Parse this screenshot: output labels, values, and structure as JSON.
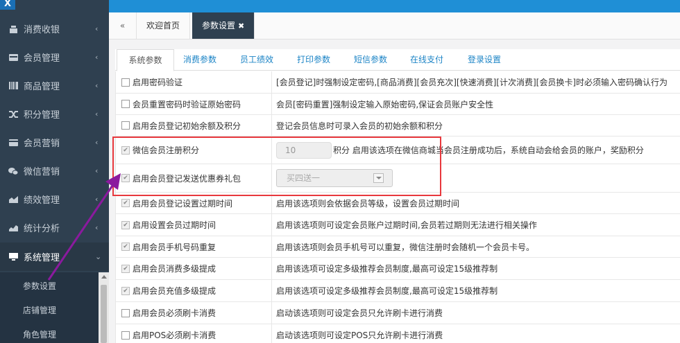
{
  "logo": {
    "text": "X"
  },
  "sidebar": {
    "items": [
      {
        "label": "消费收银",
        "icon": "cash-register-icon"
      },
      {
        "label": "会员管理",
        "icon": "id-card-icon"
      },
      {
        "label": "商品管理",
        "icon": "barcode-icon"
      },
      {
        "label": "积分管理",
        "icon": "shuffle-icon"
      },
      {
        "label": "会员营销",
        "icon": "credit-card-icon"
      },
      {
        "label": "微信营销",
        "icon": "wechat-icon"
      },
      {
        "label": "绩效管理",
        "icon": "area-chart-icon"
      },
      {
        "label": "统计分析",
        "icon": "bar-chart-icon"
      },
      {
        "label": "系统管理",
        "icon": "monitor-icon"
      }
    ],
    "submenu": [
      "参数设置",
      "店铺管理",
      "角色管理"
    ]
  },
  "tabs": {
    "back_icon": "«",
    "items": [
      "欢迎首页",
      "参数设置"
    ],
    "close": "✖"
  },
  "subtabs": [
    "系统参数",
    "消费参数",
    "员工绩效",
    "打印参数",
    "短信参数",
    "在线支付",
    "登录设置"
  ],
  "rows": [
    {
      "label": "启用密码验证",
      "desc": "[会员登记]时强制设定密码,[商品消费][会员充次][快速消费][计次消费][会员换卡]时必须输入密码确认行为",
      "checked": false
    },
    {
      "label": "会员重置密码时验证原始密码",
      "desc": "会员[密码重置]强制设定输入原始密码,保证会员账户安全性",
      "checked": false
    },
    {
      "label": "启用会员登记初始余额及积分",
      "desc": "登记会员信息时可录入会员的初始余额和积分",
      "checked": false
    },
    {
      "label": "微信会员注册积分",
      "input_value": "10",
      "desc": "积分 启用该选项在微信商城当会员注册成功后，系统自动会给会员的账户，奖励积分",
      "checked": true
    },
    {
      "label": "启用会员登记发送优惠券礼包",
      "select_value": "买四送一",
      "desc": "",
      "checked": true
    },
    {
      "label": "启用会员登记设置过期时间",
      "desc": "启用该选项则会依据会员等级，设置会员过期时间",
      "checked": true
    },
    {
      "label": "启用设置会员过期时间",
      "desc": "启用该选项则可设定会员账户过期时间,会员若过期则无法进行相关操作",
      "checked": true
    },
    {
      "label": "启用会员手机号码重复",
      "desc": "启用该选项则会员手机号可以重复，微信注册时会随机一个会员卡号。",
      "checked": true
    },
    {
      "label": "启用会员消费多级提成",
      "desc": "启用该选项可设定多级推荐会员制度,最高可设定15级推荐制",
      "checked": true
    },
    {
      "label": "启用会员充值多级提成",
      "desc": "启用该选项可设定多级推荐会员制度,最高可设定15级推荐制",
      "checked": true
    },
    {
      "label": "启用会员必须刷卡消费",
      "desc": "启动该选项则可设定会员只允许刷卡进行消费",
      "checked": false
    },
    {
      "label": "启用POS必须刷卡消费",
      "desc": "启动该选项则可设定POS只允许刷卡进行消费",
      "checked": false
    }
  ],
  "colors": {
    "sidebar": "#2f4050",
    "topbar": "#1f8fd6",
    "link": "#1c84c6",
    "annotation_box": "#e8383d",
    "annotation_arrow": "#8b1a9e"
  }
}
